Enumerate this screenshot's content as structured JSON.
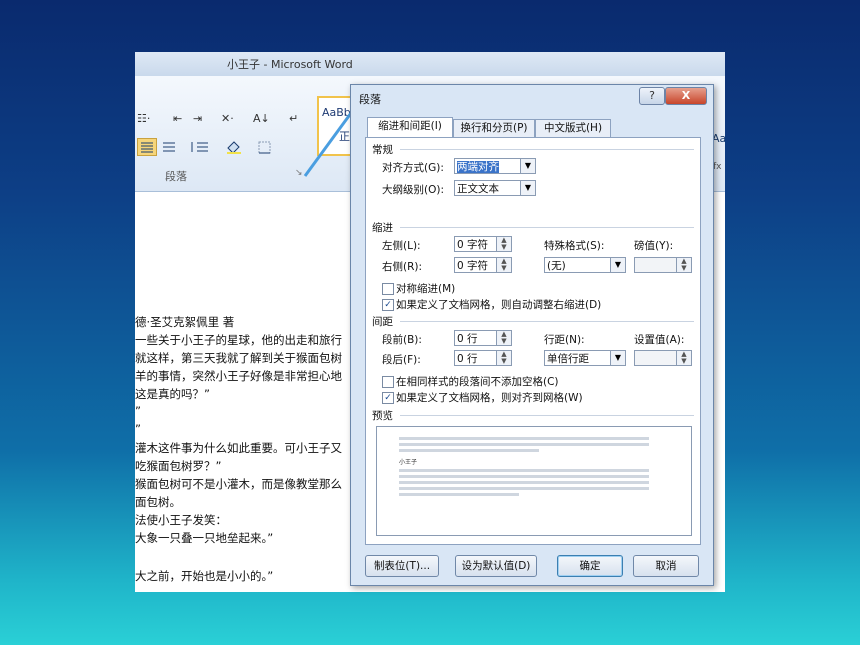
{
  "window": {
    "title": "小王子 - Microsoft Word"
  },
  "ribbon": {
    "row1": [
      "☷·",
      "⇤",
      "⇥",
      "✕·",
      "A↓",
      "↵"
    ],
    "style_preview": "AaBb(",
    "style_sub": "正",
    "group_label": "段落",
    "right_hint": "Aa",
    "right_hint2": "fx"
  },
  "document": {
    "lines": [
      "德·圣艾克絮佩里 著",
      "一些关于小王子的星球，他的出走和旅行",
      "就这样，第三天我就了解到关于猴面包树",
      "羊的事情，突然小王子好像是非常担心地",
      "这是真的吗？”",
      "”",
      "”",
      "灌木这件事为什么如此重要。可小王子又",
      "吃猴面包树罗？”",
      "猴面包树可不是小灌木，而是像教堂那么",
      "面包树。",
      "法使小王子发笑：",
      "大象一只叠一只地垒起来。”",
      "",
      "大之前，开始也是小小的。”"
    ]
  },
  "dialog": {
    "title": "段落",
    "help": "?",
    "close": "X",
    "tabs": [
      "缩进和间距(I)",
      "换行和分页(P)",
      "中文版式(H)"
    ],
    "general": {
      "section": "常规",
      "alignment_label": "对齐方式(G):",
      "alignment_value": "两端对齐",
      "outline_label": "大纲级别(O):",
      "outline_value": "正文文本"
    },
    "indent": {
      "section": "缩进",
      "left_label": "左侧(L):",
      "left_value": "0 字符",
      "right_label": "右侧(R):",
      "right_value": "0 字符",
      "special_label": "特殊格式(S):",
      "special_value": "(无)",
      "measure_label": "磅值(Y):",
      "measure_value": "",
      "mirror_label": "对称缩进(M)",
      "mirror_checked": false,
      "auto_right_label": "如果定义了文档网格，则自动调整右缩进(D)",
      "auto_right_checked": true
    },
    "spacing": {
      "section": "间距",
      "before_label": "段前(B):",
      "before_value": "0 行",
      "after_label": "段后(F):",
      "after_value": "0 行",
      "line_label": "行距(N):",
      "line_value": "单倍行距",
      "at_label": "设置值(A):",
      "at_value": "",
      "no_space_label": "在相同样式的段落间不添加空格(C)",
      "no_space_checked": false,
      "snap_label": "如果定义了文档网格，则对齐到网格(W)",
      "snap_checked": true
    },
    "preview": {
      "section": "预览",
      "sample": "小王子"
    },
    "buttons": {
      "tabs": "制表位(T)...",
      "default": "设为默认值(D)",
      "ok": "确定",
      "cancel": "取消"
    }
  }
}
